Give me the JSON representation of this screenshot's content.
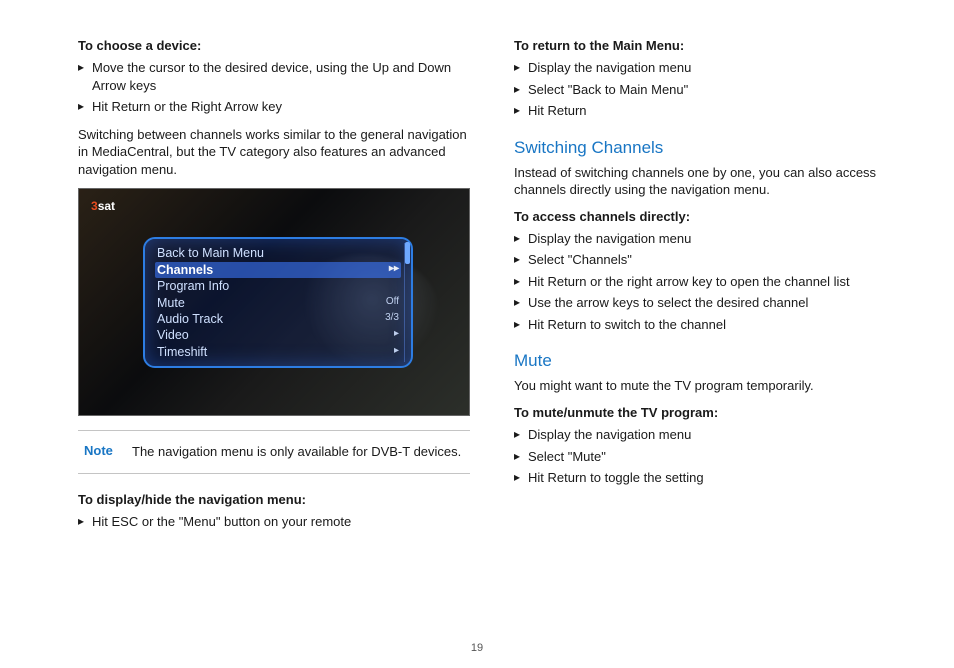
{
  "page_number": "19",
  "left": {
    "h1": "To choose a device:",
    "list1": [
      "Move the cursor to the desired device, using the Up and Down Arrow keys",
      "Hit Return or the Right Arrow key"
    ],
    "para1": "Switching between channels works similar to the general navigation in MediaCentral, but the TV category also features an advanced navigation menu.",
    "screenshot": {
      "logo_prefix": "3",
      "logo_suffix": "sat",
      "menu": [
        {
          "label": "Back to Main Menu",
          "value": ""
        },
        {
          "label": "Channels",
          "value": "▸▸",
          "highlight": true
        },
        {
          "label": "Program Info",
          "value": ""
        },
        {
          "label": "Mute",
          "value": "Off"
        },
        {
          "label": "Audio Track",
          "value": "3/3"
        },
        {
          "label": "Video",
          "value": "▸"
        },
        {
          "label": "Timeshift",
          "value": "▸"
        }
      ]
    },
    "note_label": "Note",
    "note_text": "The navigation menu is only available for DVB-T devices.",
    "h2": "To display/hide the navigation menu:",
    "list2": [
      "Hit ESC or the \"Menu\" button on your remote"
    ]
  },
  "right": {
    "h1": "To return to the Main Menu:",
    "list1": [
      "Display the navigation menu",
      "Select \"Back to Main Menu\"",
      "Hit Return"
    ],
    "sec1_title": "Switching Channels",
    "sec1_para": "Instead of switching channels one by one, you can also access channels directly using the navigation menu.",
    "h2": "To access channels directly:",
    "list2": [
      "Display the navigation menu",
      "Select \"Channels\"",
      "Hit Return or the right arrow key to open the channel list",
      "Use the arrow keys to select the desired channel",
      "Hit Return to switch to the channel"
    ],
    "sec2_title": "Mute",
    "sec2_para": "You might want to mute the TV program temporarily.",
    "h3": "To mute/unmute the TV program:",
    "list3": [
      "Display the navigation menu",
      "Select \"Mute\"",
      "Hit Return to toggle the setting"
    ]
  }
}
